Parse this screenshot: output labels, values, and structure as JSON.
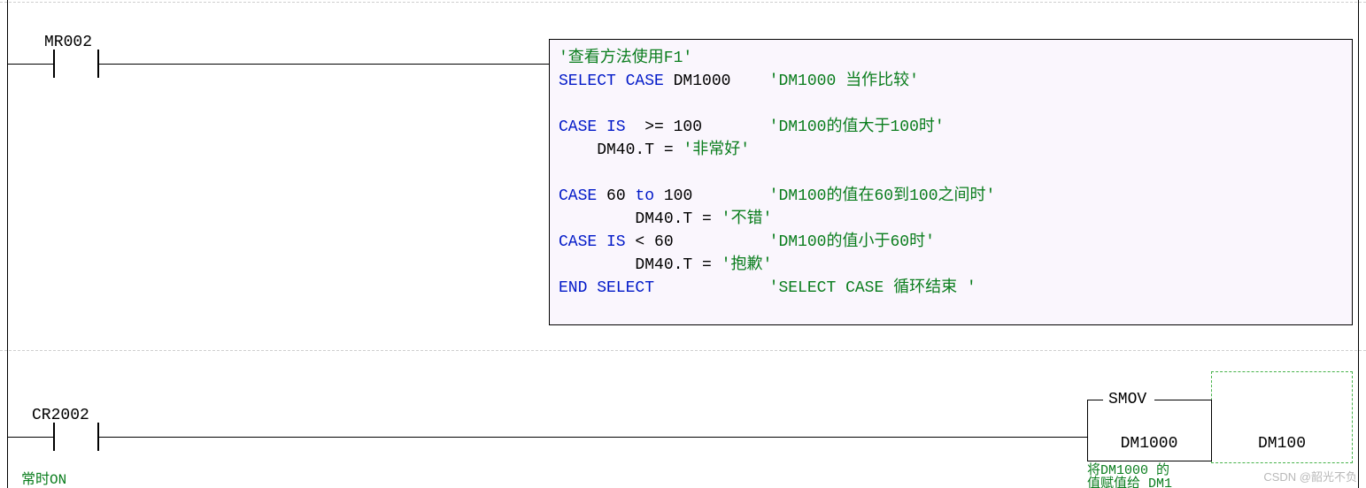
{
  "rung1": {
    "contact_label": "MR002",
    "script": {
      "l1_cmt": "'查看方法使用F1'",
      "l2_kw": "SELECT CASE",
      "l2_var": " DM1000    ",
      "l2_cmt": "'DM1000 当作比较'",
      "l4_kw": "CASE IS",
      "l4_op": "  >= 100       ",
      "l4_cmt": "'DM100的值大于100时'",
      "l5_lhs": "    DM40.T = ",
      "l5_str": "'非常好'",
      "l7_kw1": "CASE",
      "l7_n1": " 60 ",
      "l7_kw2": "to",
      "l7_n2": " 100        ",
      "l7_cmt": "'DM100的值在60到100之间时'",
      "l8_lhs": "        DM40.T = ",
      "l8_str": "'不错'",
      "l9_kw": "CASE IS",
      "l9_op": " < 60          ",
      "l9_cmt": "'DM100的值小于60时'",
      "l10_lhs": "        DM40.T = ",
      "l10_str": "'抱歉'",
      "l11_kw": "END SELECT",
      "l11_sp": "            ",
      "l11_cmt": "'SELECT CASE 循环结束 '"
    }
  },
  "rung2": {
    "contact_label": "CR2002",
    "contact_note": "常时ON",
    "func": {
      "name": "SMOV",
      "param1": "DM1000",
      "param2": "DM100",
      "note": "将DM1000 的\n值赋值给 DM1"
    }
  },
  "watermark": "CSDN @韶光不负"
}
